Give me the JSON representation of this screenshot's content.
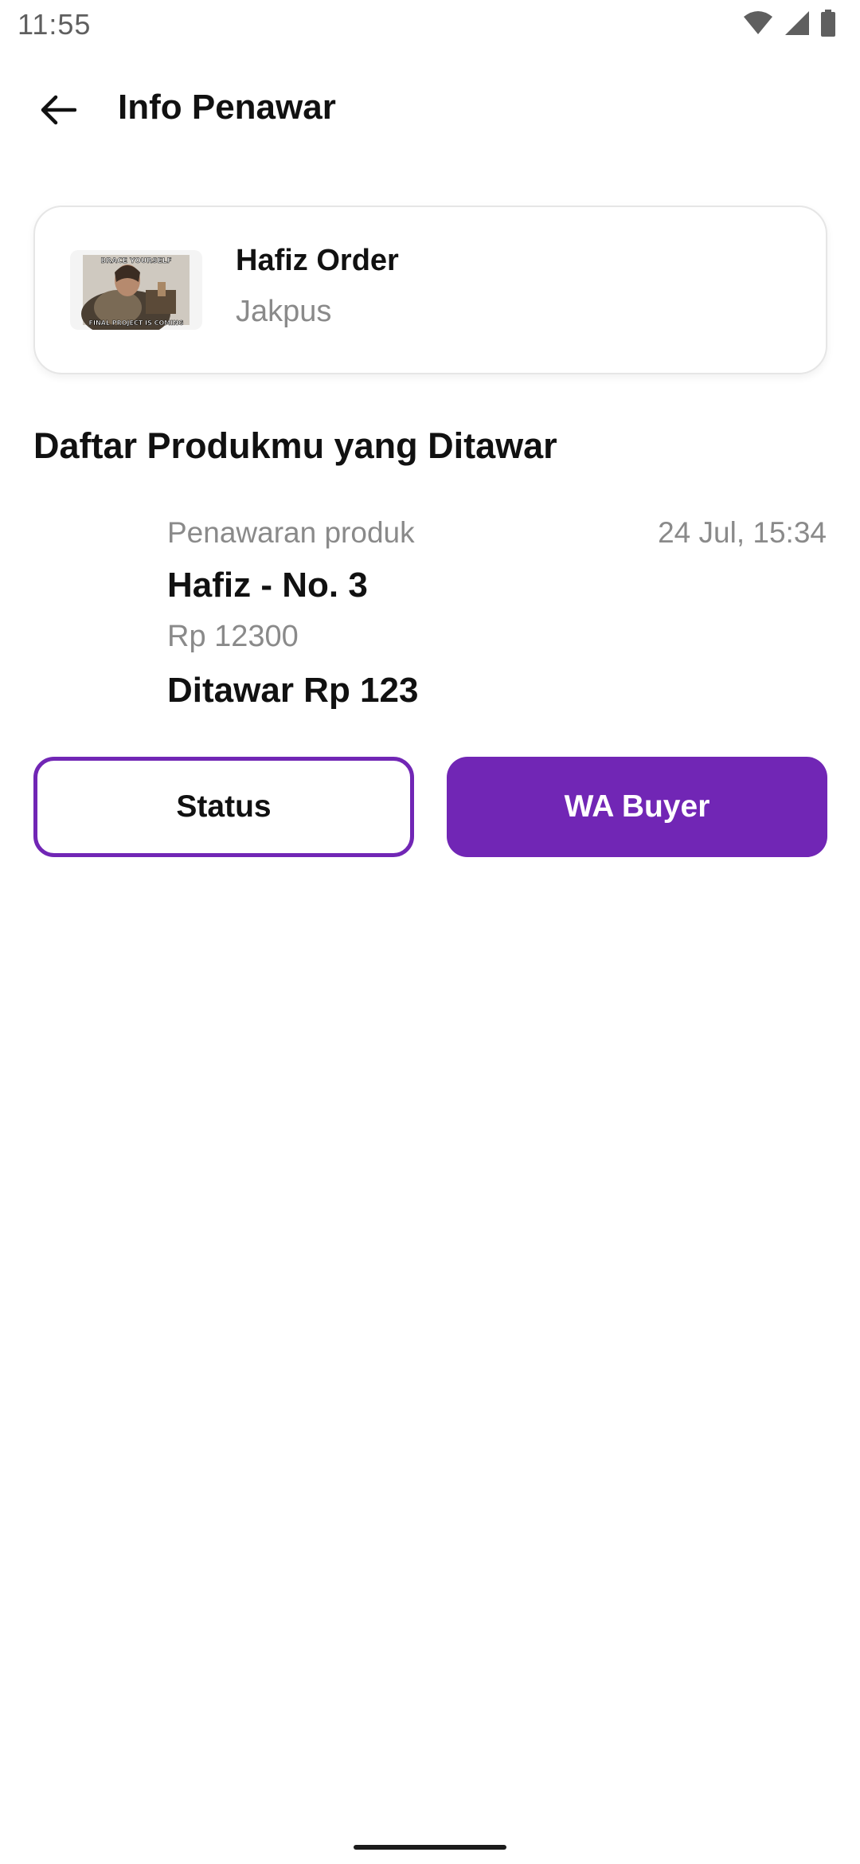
{
  "status_bar": {
    "time": "11:55",
    "icons": [
      "wifi-icon",
      "signal-icon",
      "battery-icon"
    ]
  },
  "app_bar": {
    "back_icon": "arrow-left-icon",
    "title": "Info Penawar"
  },
  "buyer": {
    "name": "Hafiz Order",
    "city": "Jakpus",
    "avatar_top_text": "BRACE YOURSELF",
    "avatar_bottom_text": "FINAL PROJECT IS COMING"
  },
  "section": {
    "title": "Daftar Produkmu yang Ditawar"
  },
  "offer": {
    "type_label": "Penawaran produk",
    "timestamp": "24 Jul, 15:34",
    "product_name": "Hafiz - No. 3",
    "price": "Rp 12300",
    "bid": "Ditawar Rp 123"
  },
  "actions": {
    "status_label": "Status",
    "wa_label": "WA Buyer"
  },
  "colors": {
    "primary": "#7126b5",
    "text_secondary": "#8a8a8a",
    "text_primary": "#111111"
  }
}
